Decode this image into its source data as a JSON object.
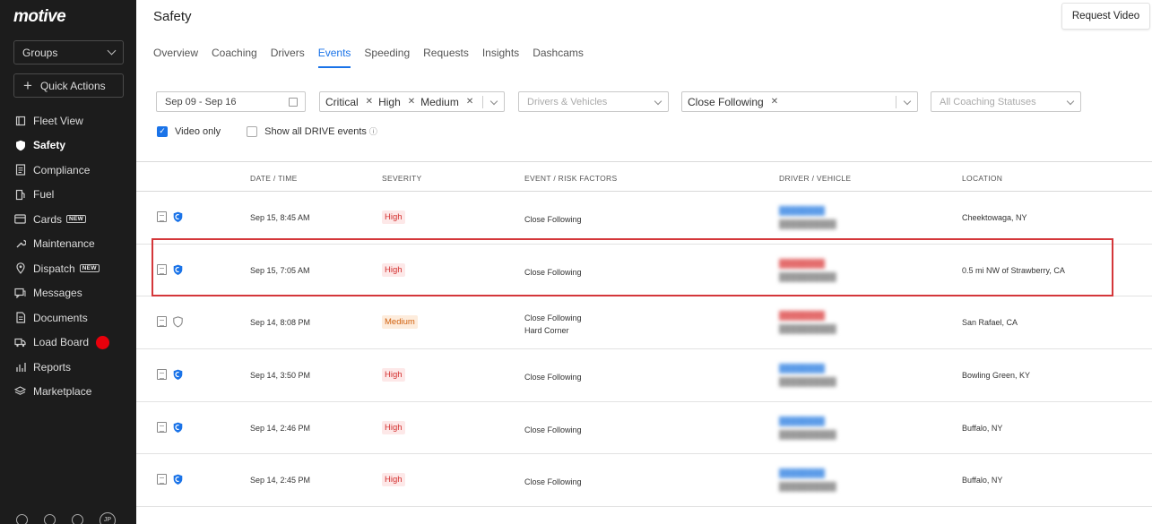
{
  "brand": {
    "logo_text": "motive"
  },
  "sidebar": {
    "groups_label": "Groups",
    "quick_actions_label": "Quick Actions",
    "items": [
      {
        "label": "Fleet View",
        "icon": "book-icon",
        "active": false,
        "badge": ""
      },
      {
        "label": "Safety",
        "icon": "shield-icon",
        "active": true,
        "badge": ""
      },
      {
        "label": "Compliance",
        "icon": "document-icon",
        "active": false,
        "badge": ""
      },
      {
        "label": "Fuel",
        "icon": "fuel-icon",
        "active": false,
        "badge": ""
      },
      {
        "label": "Cards",
        "icon": "card-icon",
        "active": false,
        "badge": "NEW"
      },
      {
        "label": "Maintenance",
        "icon": "wrench-icon",
        "active": false,
        "badge": ""
      },
      {
        "label": "Dispatch",
        "icon": "pin-icon",
        "active": false,
        "badge": "NEW"
      },
      {
        "label": "Messages",
        "icon": "message-icon",
        "active": false,
        "badge": ""
      },
      {
        "label": "Documents",
        "icon": "file-icon",
        "active": false,
        "badge": ""
      },
      {
        "label": "Load Board",
        "icon": "truck-icon",
        "active": false,
        "badge": "",
        "dot_color": "#e8000b"
      },
      {
        "label": "Reports",
        "icon": "chart-icon",
        "active": false,
        "badge": ""
      },
      {
        "label": "Marketplace",
        "icon": "layers-icon",
        "active": false,
        "badge": ""
      }
    ],
    "user_initials": "JP"
  },
  "header": {
    "title": "Safety",
    "request_video_label": "Request Video"
  },
  "tabs": [
    {
      "label": "Overview",
      "active": false
    },
    {
      "label": "Coaching",
      "active": false
    },
    {
      "label": "Drivers",
      "active": false
    },
    {
      "label": "Events",
      "active": true
    },
    {
      "label": "Speeding",
      "active": false
    },
    {
      "label": "Requests",
      "active": false
    },
    {
      "label": "Insights",
      "active": false
    },
    {
      "label": "Dashcams",
      "active": false
    }
  ],
  "filters": {
    "date_range": "Sep 09 - Sep 16",
    "severity_chips": [
      "Critical",
      "High",
      "Medium"
    ],
    "drivers_placeholder": "Drivers & Vehicles",
    "event_chips": [
      "Close Following"
    ],
    "coaching_placeholder": "All Coaching Statuses",
    "video_only_label": "Video only",
    "video_only_checked": true,
    "show_drive_label": "Show all DRIVE events",
    "show_drive_checked": false
  },
  "table": {
    "columns": [
      "DATE / TIME",
      "SEVERITY",
      "EVENT / RISK FACTORS",
      "DRIVER / VEHICLE",
      "LOCATION"
    ],
    "rows": [
      {
        "datetime": "Sep 15, 8:45 AM",
        "severity": "High",
        "events": [
          "Close Following"
        ],
        "location": "Cheektowaga, NY",
        "coached": true,
        "driver_style": "blue"
      },
      {
        "datetime": "Sep 15, 7:05 AM",
        "severity": "High",
        "events": [
          "Close Following"
        ],
        "location": "0.5 mi NW of Strawberry, CA",
        "coached": true,
        "driver_style": "red"
      },
      {
        "datetime": "Sep 14, 8:08 PM",
        "severity": "Medium",
        "events": [
          "Close Following",
          "Hard Corner"
        ],
        "location": "San Rafael, CA",
        "coached": false,
        "driver_style": "red"
      },
      {
        "datetime": "Sep 14, 3:50 PM",
        "severity": "High",
        "events": [
          "Close Following"
        ],
        "location": "Bowling Green, KY",
        "coached": true,
        "driver_style": "blue"
      },
      {
        "datetime": "Sep 14, 2:46 PM",
        "severity": "High",
        "events": [
          "Close Following"
        ],
        "location": "Buffalo, NY",
        "coached": true,
        "driver_style": "blue"
      },
      {
        "datetime": "Sep 14, 2:45 PM",
        "severity": "High",
        "events": [
          "Close Following"
        ],
        "location": "Buffalo, NY",
        "coached": true,
        "driver_style": "blue"
      }
    ]
  },
  "colors": {
    "accent": "#1a73e8",
    "sidebar_bg": "#1c1c1c",
    "high": "#d3302f",
    "medium": "#d16210",
    "highlight_box": "#d4373a"
  }
}
